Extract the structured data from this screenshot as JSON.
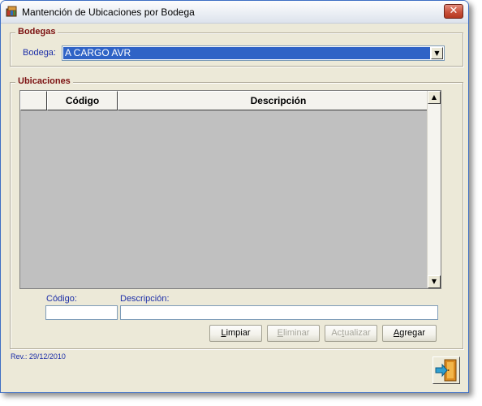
{
  "window": {
    "title": "Mantención de Ubicaciones por Bodega",
    "app_icon": "books-icon",
    "close_label": "✕"
  },
  "bodegas": {
    "group_title": "Bodegas",
    "label": "Bodega:",
    "selected": "A CARGO AVR",
    "arrow": "▼"
  },
  "ubicaciones": {
    "group_title": "Ubicaciones",
    "columns": [
      "",
      "Código",
      "Descripción"
    ],
    "rows": [],
    "scroll_up": "▲",
    "scroll_down": "▼"
  },
  "form": {
    "codigo_label": "Código:",
    "descripcion_label": "Descripción:",
    "codigo_value": "",
    "descripcion_value": ""
  },
  "buttons": {
    "limpiar": {
      "mnemonic": "L",
      "rest": "impiar",
      "enabled": true
    },
    "eliminar": {
      "mnemonic": "E",
      "rest": "liminar",
      "enabled": false
    },
    "actualizar": {
      "pre": "Ac",
      "mnemonic": "t",
      "rest": "ualizar",
      "enabled": false
    },
    "agregar": {
      "mnemonic": "A",
      "rest": "gregar",
      "enabled": true
    }
  },
  "footer": {
    "revision": "Rev.: 29/12/2010",
    "exit_icon": "exit-door-icon"
  },
  "colors": {
    "title_bar": "#eef1f6",
    "client_bg": "#ece9d8",
    "group_title": "#7b1010",
    "label_blue": "#1d2fa8",
    "selection": "#2f63c6",
    "grid_empty": "#c0c0c0",
    "close_button": "#c9513a"
  }
}
